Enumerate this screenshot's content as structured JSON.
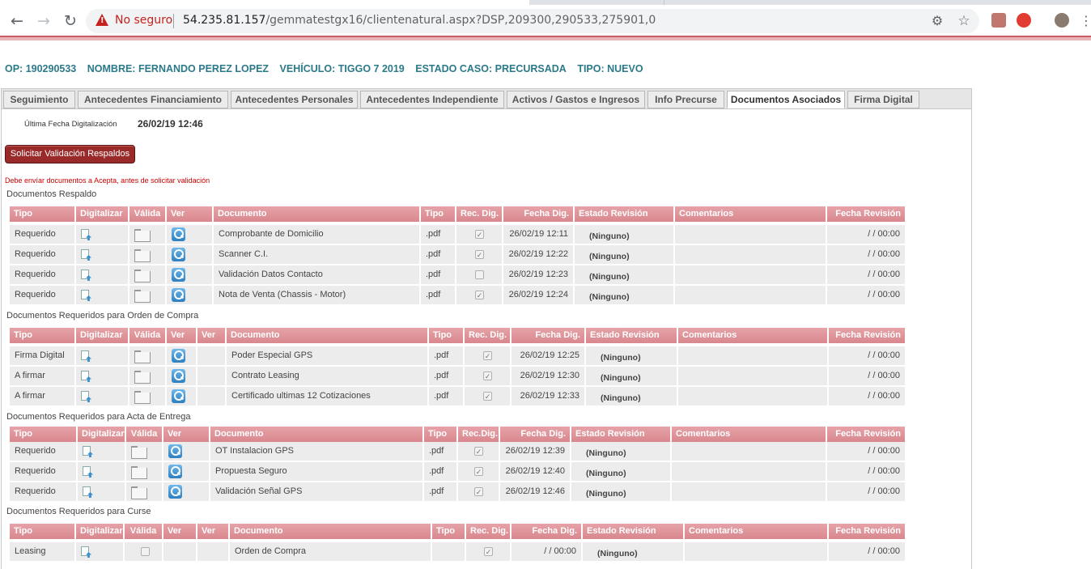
{
  "browser": {
    "security_label": "No seguro",
    "url_host": "54.235.81.157",
    "url_path": "/gemmatestgx16/clientenatural.aspx?DSP,209300,290533,275901,0"
  },
  "case_header": {
    "op": "OP: 190290533",
    "nombre": "NOMBRE: FERNANDO PEREZ LOPEZ",
    "vehiculo": "VEHÍCULO: TIGGO 7 2019",
    "estado": "ESTADO CASO: PRECURSADA",
    "tipo": "TIPO: NUEVO"
  },
  "tabs": [
    {
      "label": "Seguimiento"
    },
    {
      "label": "Antecedentes Financiamiento"
    },
    {
      "label": "Antecedentes Personales"
    },
    {
      "label": "Antecedentes Independiente"
    },
    {
      "label": "Activos / Gastos e Ingresos"
    },
    {
      "label": "Info Precurse"
    },
    {
      "label": "Documentos Asociados"
    },
    {
      "label": "Firma Digital"
    }
  ],
  "active_tab": "Documentos Asociados",
  "panel": {
    "ultima_label": "Última Fecha Digitalización",
    "ultima_value": "26/02/19 12:46",
    "solicitar_button": "Solicitar Validación Respaldos",
    "alert": "Debe envíar documentos a Acepta, antes de solicitar validación"
  },
  "sections": [
    {
      "title": "Documentos Respaldo",
      "headers": [
        "Tipo",
        "Digitalizar",
        "Válida",
        "Ver",
        "Documento",
        "Tipo",
        "Rec. Dig.",
        "Fecha Dig.",
        "Estado Revisión",
        "Comentarios",
        "Fecha Revisión"
      ],
      "rows": [
        {
          "tipo": "Requerido",
          "documento": "Comprobante de Domicilio",
          "ext": ".pdf",
          "rec": true,
          "fecha": "26/02/19 12:11",
          "estado": "(Ninguno)",
          "comentarios": "",
          "fecha_rev": "/ / 00:00"
        },
        {
          "tipo": "Requerido",
          "documento": "Scanner C.I.",
          "ext": ".pdf",
          "rec": true,
          "fecha": "26/02/19 12:22",
          "estado": "(Ninguno)",
          "comentarios": "",
          "fecha_rev": "/ / 00:00"
        },
        {
          "tipo": "Requerido",
          "documento": "Validación Datos Contacto",
          "ext": ".pdf",
          "rec": false,
          "fecha": "26/02/19 12:23",
          "estado": "(Ninguno)",
          "comentarios": "",
          "fecha_rev": "/ / 00:00"
        },
        {
          "tipo": "Requerido",
          "documento": "Nota de Venta (Chassis - Motor)",
          "ext": ".pdf",
          "rec": true,
          "fecha": "26/02/19 12:24",
          "estado": "(Ninguno)",
          "comentarios": "",
          "fecha_rev": "/ / 00:00"
        }
      ]
    },
    {
      "title": "Documentos Requeridos para Orden de Compra",
      "headers": [
        "Tipo",
        "Digitalizar",
        "Válida",
        "Ver",
        "Ver",
        "Documento",
        "Tipo",
        "Rec. Dig.",
        "Fecha Dig.",
        "Estado Revisión",
        "Comentarios",
        "Fecha Revisión"
      ],
      "rows": [
        {
          "tipo": "Firma Digital",
          "documento": "Poder Especial GPS",
          "ext": ".pdf",
          "rec": true,
          "fecha": "26/02/19 12:25",
          "estado": "(Ninguno)",
          "comentarios": "",
          "fecha_rev": "/ / 00:00"
        },
        {
          "tipo": "A firmar",
          "documento": "Contrato Leasing",
          "ext": ".pdf",
          "rec": true,
          "fecha": "26/02/19 12:30",
          "estado": "(Ninguno)",
          "comentarios": "",
          "fecha_rev": "/ / 00:00"
        },
        {
          "tipo": "A firmar",
          "documento": "Certificado ultimas 12 Cotizaciones",
          "ext": ".pdf",
          "rec": true,
          "fecha": "26/02/19 12:33",
          "estado": "(Ninguno)",
          "comentarios": "",
          "fecha_rev": "/ / 00:00"
        }
      ]
    },
    {
      "title": "Documentos Requeridos para Acta de Entrega",
      "headers": [
        "Tipo",
        "Digitalizar",
        "Válida",
        "Ver",
        "Documento",
        "Tipo",
        "Rec.Dig.",
        "Fecha Dig.",
        "Estado Revisión",
        "Comentarios",
        "Fecha Revisión"
      ],
      "rows": [
        {
          "tipo": "Requerido",
          "documento": "OT Instalacion GPS",
          "ext": ".pdf",
          "rec": true,
          "fecha": "26/02/19 12:39",
          "estado": "(Ninguno)",
          "comentarios": "",
          "fecha_rev": "/ / 00:00"
        },
        {
          "tipo": "Requerido",
          "documento": "Propuesta Seguro",
          "ext": ".pdf",
          "rec": true,
          "fecha": "26/02/19 12:40",
          "estado": "(Ninguno)",
          "comentarios": "",
          "fecha_rev": "/ / 00:00"
        },
        {
          "tipo": "Requerido",
          "documento": "Validación Señal GPS",
          "ext": ".pdf",
          "rec": true,
          "fecha": "26/02/19 12:46",
          "estado": "(Ninguno)",
          "comentarios": "",
          "fecha_rev": "/ / 00:00"
        }
      ]
    },
    {
      "title": "Documentos Requeridos para Curse",
      "headers": [
        "Tipo",
        "Digitalizar",
        "Válida",
        "Ver",
        "Ver",
        "Documento",
        "Tipo",
        "Rec. Dig.",
        "Fecha Dig.",
        "Estado Revisión",
        "Comentarios",
        "Fecha Revisión"
      ],
      "rows": [
        {
          "tipo": "Leasing",
          "documento": "Orden de Compra",
          "ext": "",
          "rec": true,
          "fecha": "/ / 00:00",
          "estado": "(Ninguno)",
          "comentarios": "",
          "fecha_rev": "/ / 00:00"
        }
      ]
    }
  ]
}
